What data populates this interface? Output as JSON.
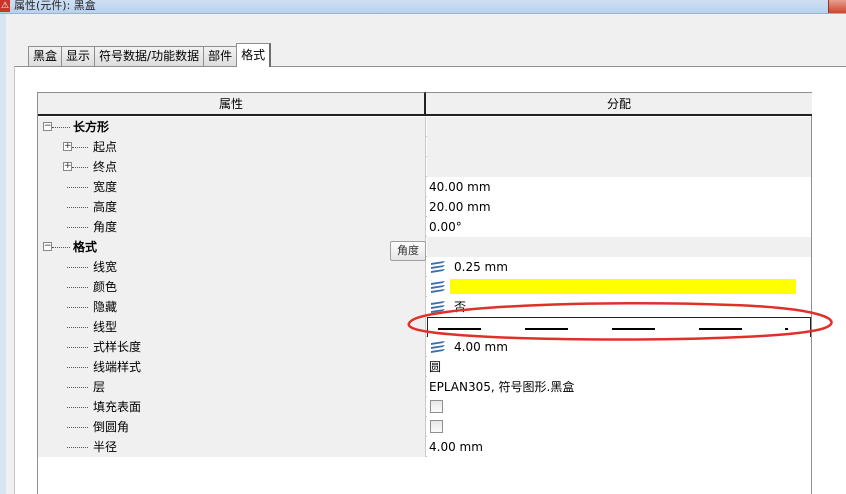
{
  "window": {
    "title": "属性(元件): 黑盒"
  },
  "tabs": [
    {
      "label": "黑盒",
      "active": false
    },
    {
      "label": "显示",
      "active": false
    },
    {
      "label": "符号数据/功能数据",
      "active": false
    },
    {
      "label": "部件",
      "active": false
    },
    {
      "label": "格式",
      "active": true
    }
  ],
  "grid": {
    "header": {
      "property": "属性",
      "value": "分配"
    },
    "rows": [
      {
        "label": "长方形",
        "value": ""
      },
      {
        "label": "起点",
        "value": ""
      },
      {
        "label": "终点",
        "value": ""
      },
      {
        "label": "宽度",
        "value": "40.00 mm"
      },
      {
        "label": "高度",
        "value": "20.00 mm"
      },
      {
        "label": "角度",
        "value": "0.00°"
      },
      {
        "label": "格式",
        "value": ""
      },
      {
        "label": "线宽",
        "value": "0.25 mm"
      },
      {
        "label": "颜色",
        "value": "",
        "color": "#ffff00"
      },
      {
        "label": "隐藏",
        "value": "否"
      },
      {
        "label": "线型",
        "value": ""
      },
      {
        "label": "式样长度",
        "value": "4.00 mm"
      },
      {
        "label": "线端样式",
        "value": "圆"
      },
      {
        "label": "层",
        "value": "EPLAN305, 符号图形.黑盒"
      },
      {
        "label": "填充表面",
        "checked": false
      },
      {
        "label": "倒圆角",
        "checked": false
      },
      {
        "label": "半径",
        "value": "4.00 mm"
      }
    ]
  },
  "tooltip": {
    "text": "角度"
  },
  "colors": {
    "annotation": "#e0302a",
    "swatch": "#ffff00",
    "icon": "#3a6fb0"
  }
}
